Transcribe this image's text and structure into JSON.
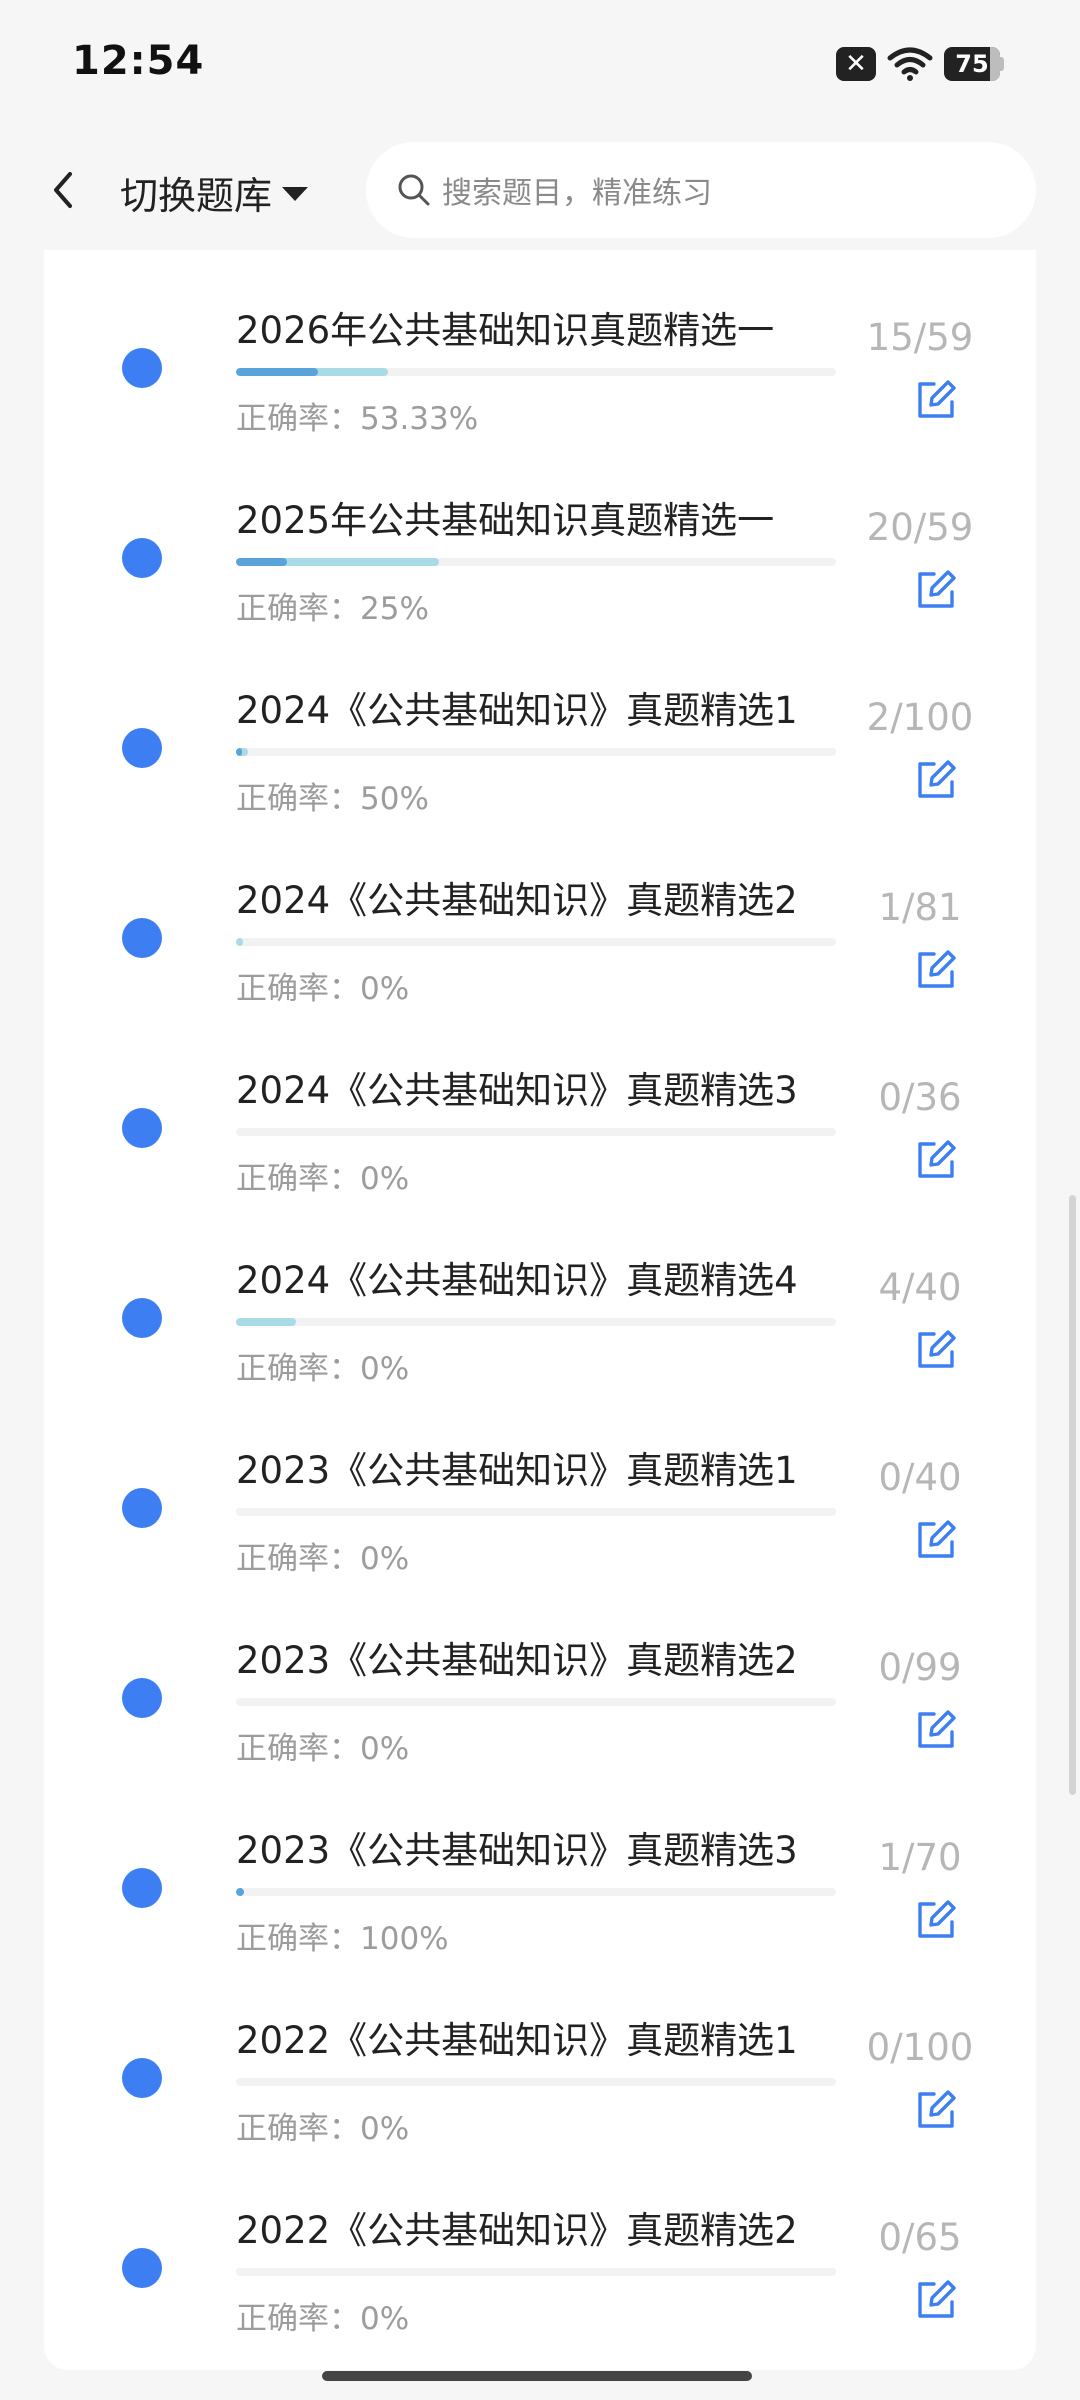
{
  "status_bar": {
    "time": "12:54",
    "battery": "75"
  },
  "header": {
    "switch_label": "切换题库",
    "search_placeholder": "搜索题目，精准练习"
  },
  "items": [
    {
      "title": "2026年公共基础知识真题精选一",
      "accuracy": "正确率：53.33%",
      "progress": "15/59",
      "answered_fraction": 0.254,
      "correct_fraction": 0.136
    },
    {
      "title": "2025年公共基础知识真题精选一",
      "accuracy": "正确率：25%",
      "progress": "20/59",
      "answered_fraction": 0.339,
      "correct_fraction": 0.085
    },
    {
      "title": "2024《公共基础知识》真题精选1",
      "accuracy": "正确率：50%",
      "progress": "2/100",
      "answered_fraction": 0.02,
      "correct_fraction": 0.01
    },
    {
      "title": "2024《公共基础知识》真题精选2",
      "accuracy": "正确率：0%",
      "progress": "1/81",
      "answered_fraction": 0.012,
      "correct_fraction": 0
    },
    {
      "title": "2024《公共基础知识》真题精选3",
      "accuracy": "正确率：0%",
      "progress": "0/36",
      "answered_fraction": 0,
      "correct_fraction": 0
    },
    {
      "title": "2024《公共基础知识》真题精选4",
      "accuracy": "正确率：0%",
      "progress": "4/40",
      "answered_fraction": 0.1,
      "correct_fraction": 0
    },
    {
      "title": "2023《公共基础知识》真题精选1",
      "accuracy": "正确率：0%",
      "progress": "0/40",
      "answered_fraction": 0,
      "correct_fraction": 0
    },
    {
      "title": "2023《公共基础知识》真题精选2",
      "accuracy": "正确率：0%",
      "progress": "0/99",
      "answered_fraction": 0,
      "correct_fraction": 0
    },
    {
      "title": "2023《公共基础知识》真题精选3",
      "accuracy": "正确率：100%",
      "progress": "1/70",
      "answered_fraction": 0.014,
      "correct_fraction": 0.014
    },
    {
      "title": "2022《公共基础知识》真题精选1",
      "accuracy": "正确率：0%",
      "progress": "0/100",
      "answered_fraction": 0,
      "correct_fraction": 0
    },
    {
      "title": "2022《公共基础知识》真题精选2",
      "accuracy": "正确率：0%",
      "progress": "0/65",
      "answered_fraction": 0,
      "correct_fraction": 0
    }
  ],
  "icons": {
    "back": "chevron-left-icon",
    "caret": "caret-down-icon",
    "search": "search-icon",
    "edit": "edit-icon",
    "dot": "status-dot"
  },
  "colors": {
    "accent_blue": "#3d7ff2",
    "progress_dark": "#5aa3d8",
    "progress_light": "#a8dbe6",
    "muted_text": "#9c9c9c"
  }
}
